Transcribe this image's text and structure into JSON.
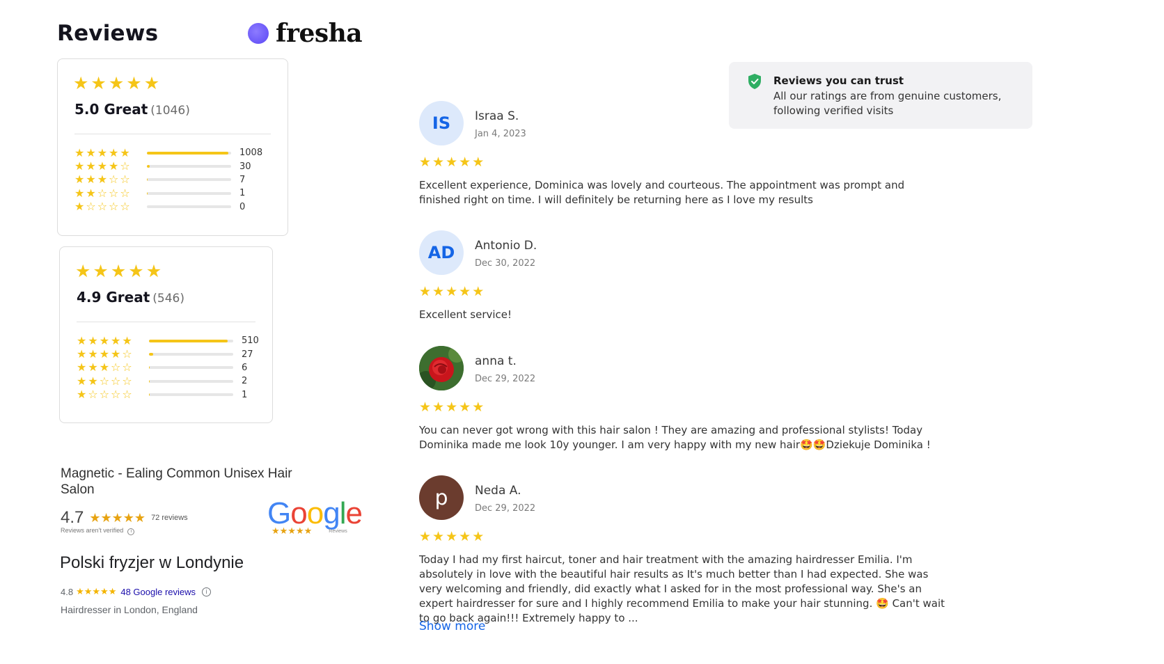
{
  "header": {
    "title": "Reviews",
    "brand": "fresha"
  },
  "rating_cards": [
    {
      "score_label": "5.0 Great",
      "count": "(1046)",
      "distribution": [
        {
          "stars": 5,
          "count": "1008",
          "fraction": 0.964
        },
        {
          "stars": 4,
          "count": "30",
          "fraction": 0.029
        },
        {
          "stars": 3,
          "count": "7",
          "fraction": 0.007
        },
        {
          "stars": 2,
          "count": "1",
          "fraction": 0.001
        },
        {
          "stars": 1,
          "count": "0",
          "fraction": 0.0
        }
      ]
    },
    {
      "score_label": "4.9 Great",
      "count": "(546)",
      "distribution": [
        {
          "stars": 5,
          "count": "510",
          "fraction": 0.934
        },
        {
          "stars": 4,
          "count": "27",
          "fraction": 0.049
        },
        {
          "stars": 3,
          "count": "6",
          "fraction": 0.011
        },
        {
          "stars": 2,
          "count": "2",
          "fraction": 0.004
        },
        {
          "stars": 1,
          "count": "1",
          "fraction": 0.002
        }
      ]
    }
  ],
  "google_listing_1": {
    "name": "Magnetic - Ealing Common Unisex Hair Salon",
    "score": "4.7",
    "stars": "★★★★★",
    "reviews": "72 reviews",
    "note": "Reviews aren't verified",
    "logo_text": "Google",
    "logo_sub": "Reviews"
  },
  "google_listing_2": {
    "name": "Polski fryzjer w Londynie",
    "score": "4.8",
    "stars": "★★★★★",
    "reviews_link": "48 Google reviews",
    "type": "Hairdresser in London, England"
  },
  "trust": {
    "title": "Reviews you can trust",
    "text": "All our ratings are from genuine customers, following verified visits",
    "icon": "shield-check-icon",
    "icon_color": "#2fae63"
  },
  "reviews": [
    {
      "initials": "IS",
      "name": "Israa S.",
      "date": "Jan 4, 2023",
      "stars": 5,
      "text": "Excellent experience, Dominica was lovely and courteous. The appointment was prompt and finished right on time. I will definitely be returning here as I love my results"
    },
    {
      "initials": "AD",
      "name": "Antonio D.",
      "date": "Dec 30, 2022",
      "stars": 5,
      "text": "Excellent service!"
    },
    {
      "initials": "",
      "name": "anna t.",
      "date": "Dec 29, 2022",
      "stars": 5,
      "text": "You can never got wrong with this hair salon ! They are amazing and professional stylists! Today Dominika made me look 10y younger. I am very happy with my new hair🤩🤩Dziekuje Dominika !"
    },
    {
      "initials": "p",
      "name": "Neda A.",
      "date": "Dec 29, 2022",
      "stars": 5,
      "text": "Today I had my first haircut, toner and hair treatment with the amazing hairdresser Emilia. I'm absolutely in love with the beautiful hair results as It's much better than I had expected. She was very welcoming and friendly, did exactly what I asked for in the most professional way. She's an expert hairdresser for sure and I highly recommend Emilia to make your hair stunning. 🤩 Can't wait to go back again!!! Extremely happy to ..."
    }
  ],
  "show_more": "Show more",
  "colors": {
    "star": "#f5c518",
    "accent": "#1565e6",
    "avatar_bg": "#dde9fb"
  }
}
